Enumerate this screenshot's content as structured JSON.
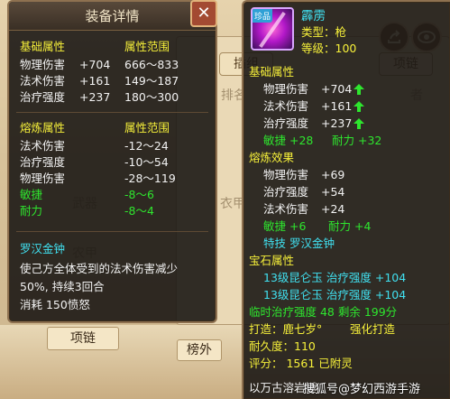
{
  "background": {
    "tabs": [
      "插组",
      "项链"
    ],
    "faded_cells": [
      "排名",
      "武器",
      "武器",
      "武器",
      "衣甲",
      "农甲",
      "榜外",
      "者"
    ],
    "bottom_tags": [
      "项链",
      "榜外"
    ]
  },
  "equipment_detail": {
    "title": "装备详情",
    "base": {
      "header_name": "基础属性",
      "header_range": "属性范围",
      "rows": [
        {
          "name": "物理伤害",
          "value": "+704",
          "range": "666～833"
        },
        {
          "name": "法术伤害",
          "value": "+161",
          "range": "149～187"
        },
        {
          "name": "治疗强度",
          "value": "+237",
          "range": "180～300"
        }
      ]
    },
    "refine": {
      "header_name": "熔炼属性",
      "header_range": "属性范围",
      "rows": [
        {
          "name": "法术伤害",
          "range": "-12～24",
          "color": "w"
        },
        {
          "name": "治疗强度",
          "range": "-10～54",
          "color": "w"
        },
        {
          "name": "物理伤害",
          "range": "-28～119",
          "color": "w"
        },
        {
          "name": "敏捷",
          "range": "-8～6",
          "color": "g"
        },
        {
          "name": "耐力",
          "range": "-8～4",
          "color": "g"
        }
      ]
    },
    "special": {
      "name": "罗汉金钟",
      "desc_line1": "使己方全体受到的法术伤害减少",
      "desc_line2": "50%, 持续3回合",
      "cost": "消耗 150愤怒"
    }
  },
  "item": {
    "badge": "珍品",
    "name": "霹雳",
    "type": "类型：枪",
    "level": "等级：100",
    "base_title": "基础属性",
    "base_rows": [
      {
        "name": "物理伤害",
        "value": "+704"
      },
      {
        "name": "法术伤害",
        "value": "+161"
      },
      {
        "name": "治疗强度",
        "value": "+237"
      }
    ],
    "base_green": {
      "agility": "敏捷 +28",
      "stamina": "耐力 +32"
    },
    "refine_title": "熔炼效果",
    "refine_rows": [
      {
        "name": "物理伤害",
        "value": "+69"
      },
      {
        "name": "治疗强度",
        "value": "+54"
      },
      {
        "name": "法术伤害",
        "value": "+24"
      }
    ],
    "refine_green": {
      "agility": "敏捷 +6",
      "stamina": "耐力 +4"
    },
    "skill": "特技  罗汉金钟",
    "gem_title": "宝石属性",
    "gem_rows": [
      "13级昆仑玉 治疗强度 +104",
      "13级昆仑玉 治疗强度 +104"
    ],
    "temp": "临时治疗强度 48  剩余 199分",
    "maker": "打造：鹿七岁°",
    "enhance": "强化打造",
    "durability": "耐久度：110",
    "score": "评分： 1561   已附灵",
    "footer": "以万古溶岩锤"
  },
  "watermark": "搜狐号@梦幻西游手游",
  "colors": {
    "gold": "#f7f13a",
    "green": "#2ee62e",
    "cyan": "#40e0f0",
    "white": "#f2f2f2"
  }
}
